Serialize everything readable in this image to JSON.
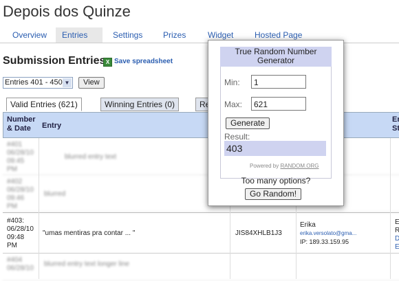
{
  "app": {
    "title": "Depois dos Quinze"
  },
  "nav": {
    "tabs": [
      {
        "label": "Overview"
      },
      {
        "label": "Entries"
      },
      {
        "label": "Settings"
      },
      {
        "label": "Prizes"
      },
      {
        "label": "Widget"
      },
      {
        "label": "Hosted Page"
      }
    ]
  },
  "section": {
    "title": "Submission Entries",
    "save_link": "Save spreadsheet",
    "save_icon": "excel-icon"
  },
  "range": {
    "selected": "Entries 401 - 450",
    "view_label": "View"
  },
  "entry_tabs": {
    "valid": "Valid Entries (621)",
    "winning": "Winning Entries (0)",
    "third": "Re"
  },
  "table": {
    "headers": {
      "number_date": "Number & Date",
      "entry": "Entry",
      "last": "Er St"
    },
    "highlighted_row": {
      "number": "#403:",
      "date": "06/28/10",
      "time": "09:48",
      "ampm": "PM",
      "entry": "\"umas mentiras pra contar ... \"",
      "code": "JIS84XHLB1J3",
      "name": "Erika",
      "email": "erika.versolato@gma...",
      "ip": "IP: 189.33.159.95",
      "status_1": "Er",
      "status_2": "R",
      "status_3": "Di",
      "status_4": "Er"
    },
    "blurred_rows": [
      {
        "text": "#401 06/28/10 09:45 PM",
        "entry": "blurred entry text"
      },
      {
        "text": "#402 06/28/10 09:46 PM",
        "entry": "blurred"
      },
      {
        "text": "#404 06/28/10",
        "entry": "blurred entry text longer line"
      }
    ]
  },
  "rng": {
    "title": "True Random Number Generator",
    "min_label": "Min:",
    "min_value": "1",
    "max_label": "Max:",
    "max_value": "621",
    "generate_label": "Generate",
    "result_label": "Result:",
    "result_value": "403",
    "powered_by": "Powered by",
    "powered_link": "RANDOM.ORG",
    "too_many": "Too many options?",
    "go_random_label": "Go Random!"
  }
}
